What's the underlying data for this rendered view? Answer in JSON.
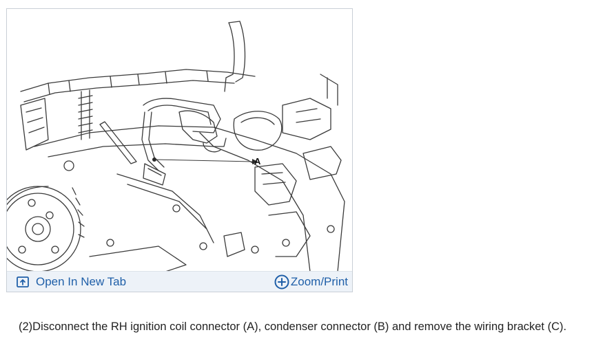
{
  "figure": {
    "callout_label": "A"
  },
  "toolbar": {
    "open_new_tab_label": "Open In New Tab",
    "zoom_print_label": "Zoom/Print"
  },
  "instruction": {
    "text": "(2)Disconnect the RH ignition coil connector (A), condenser connector (B) and remove the wiring bracket (C)."
  },
  "colors": {
    "link": "#1f5fa8",
    "toolbar_bg": "#edf2f8",
    "line_art": "#3a3a3a",
    "text": "#222222"
  },
  "icons": {
    "open_new_tab": "open-new-tab-icon",
    "zoom": "zoom-plus-circle-icon"
  }
}
